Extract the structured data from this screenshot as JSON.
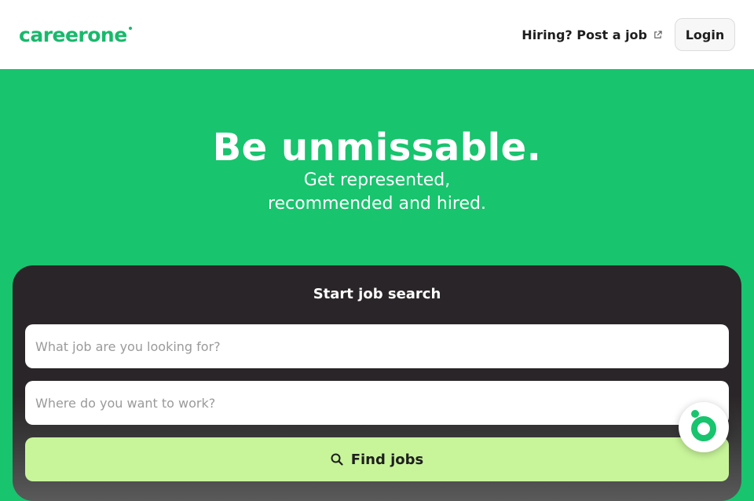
{
  "header": {
    "logo_text": "careerone",
    "post_job_label": "Hiring? Post a job",
    "login_label": "Login"
  },
  "hero": {
    "title": "Be unmissable.",
    "subtitle_line1": "Get represented,",
    "subtitle_line2": "recommended and hired."
  },
  "search": {
    "title": "Start job search",
    "what_placeholder": "What job are you looking for?",
    "where_placeholder": "Where do you want to work?",
    "find_label": "Find jobs"
  },
  "icons": {
    "external_link": "external-link-icon",
    "search": "search-icon",
    "chat": "chat-assistant-icon"
  },
  "colors": {
    "brand_green": "#18c46e",
    "card_dark": "#2a2528",
    "button_lime": "#c8f59a"
  }
}
